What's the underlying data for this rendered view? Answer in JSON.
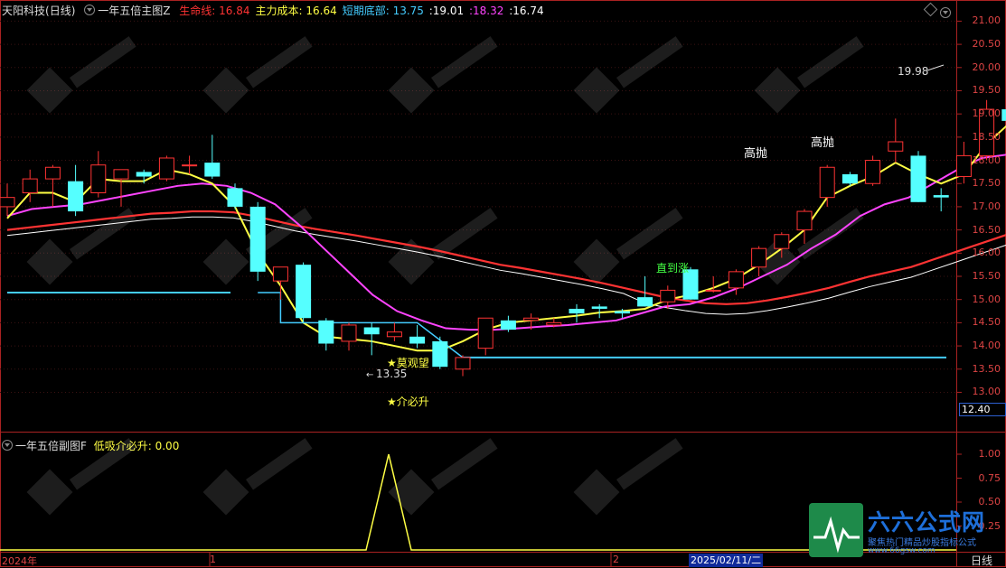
{
  "main_header": {
    "stock": "天阳科技",
    "period": "(日线)",
    "indicator": "一年五倍主图Z",
    "items": [
      {
        "label": "生命线:",
        "value": "16.84",
        "color": "#ff3333"
      },
      {
        "label": "主力成本:",
        "value": "16.64",
        "color": "#ffff44"
      },
      {
        "label": "短期底部:",
        "value": "13.75",
        "color": "#44ccff"
      },
      {
        "label": "",
        "value": ":19.01",
        "color": "#ffffff"
      },
      {
        "label": "",
        "value": ":18.32",
        "color": "#ff44ff"
      },
      {
        "label": "",
        "value": ":16.74",
        "color": "#ffffff"
      }
    ]
  },
  "sub_header": {
    "indicator": "一年五倍副图F",
    "label": "低吸介必升:",
    "value": "0.00"
  },
  "price_axis": {
    "labels": [
      "21.00",
      "20.50",
      "20.00",
      "19.50",
      "19.00",
      "18.50",
      "18.00",
      "17.50",
      "17.00",
      "16.50",
      "16.00",
      "15.50",
      "15.00",
      "14.50",
      "14.00",
      "13.50",
      "13.00"
    ],
    "current_price": "12.40"
  },
  "sub_axis": {
    "labels": [
      "1.00",
      "0.75",
      "0.50",
      "0.25"
    ]
  },
  "date_axis": {
    "start": "2024年",
    "m1": "1",
    "m2": "2",
    "cursor_date": "2025/02/11/二",
    "period": "日线"
  },
  "annotations": {
    "high_price": "19.98",
    "low_price": "13.35",
    "gaopao1": "高抛",
    "gaopao2": "高抛",
    "zhidaozhang": "直到涨",
    "moguanwang": "★莫观望",
    "jiebisheng": "★介必升"
  },
  "watermark": {
    "text": "六六公式网",
    "sub": "聚焦热门精品炒股指标公式",
    "url": "www.66gsw.com"
  },
  "colors": {
    "up": "#ff3333",
    "down": "#55ffff",
    "life": "#ff3333",
    "cost": "#ffff44",
    "bottom": "#44ccff",
    "magenta": "#ff44ff",
    "white": "#ffffff",
    "frame": "#aa2222"
  },
  "chart_data": {
    "type": "candlestick",
    "ylim": [
      12.6,
      21.3
    ],
    "candles": [
      {
        "o": 17.0,
        "h": 17.5,
        "l": 16.8,
        "c": 17.2
      },
      {
        "o": 17.3,
        "h": 17.8,
        "l": 17.1,
        "c": 17.6
      },
      {
        "o": 17.6,
        "h": 17.9,
        "l": 17.0,
        "c": 17.85
      },
      {
        "o": 17.55,
        "h": 17.9,
        "l": 16.8,
        "c": 16.9
      },
      {
        "o": 17.3,
        "h": 18.2,
        "l": 17.2,
        "c": 17.9
      },
      {
        "o": 17.6,
        "h": 17.8,
        "l": 17.0,
        "c": 17.8
      },
      {
        "o": 17.75,
        "h": 17.8,
        "l": 17.5,
        "c": 17.65
      },
      {
        "o": 17.6,
        "h": 18.1,
        "l": 17.55,
        "c": 18.05
      },
      {
        "o": 17.9,
        "h": 18.1,
        "l": 17.7,
        "c": 17.9
      },
      {
        "o": 17.95,
        "h": 18.55,
        "l": 17.6,
        "c": 17.65
      },
      {
        "o": 17.4,
        "h": 17.5,
        "l": 16.95,
        "c": 17.0
      },
      {
        "o": 17.0,
        "h": 17.1,
        "l": 15.4,
        "c": 15.6
      },
      {
        "o": 15.4,
        "h": 15.7,
        "l": 15.0,
        "c": 15.7
      },
      {
        "o": 15.75,
        "h": 15.8,
        "l": 14.5,
        "c": 14.6
      },
      {
        "o": 14.55,
        "h": 14.6,
        "l": 13.9,
        "c": 14.05
      },
      {
        "o": 14.1,
        "h": 14.5,
        "l": 13.9,
        "c": 14.45
      },
      {
        "o": 14.4,
        "h": 14.5,
        "l": 13.8,
        "c": 14.25
      },
      {
        "o": 14.2,
        "h": 14.5,
        "l": 14.1,
        "c": 14.3
      },
      {
        "o": 14.2,
        "h": 14.45,
        "l": 13.95,
        "c": 14.05
      },
      {
        "o": 14.1,
        "h": 14.2,
        "l": 13.5,
        "c": 13.55
      },
      {
        "o": 13.5,
        "h": 13.8,
        "l": 13.35,
        "c": 13.75
      },
      {
        "o": 13.95,
        "h": 14.6,
        "l": 13.8,
        "c": 14.6
      },
      {
        "o": 14.55,
        "h": 14.65,
        "l": 14.3,
        "c": 14.35
      },
      {
        "o": 14.55,
        "h": 14.7,
        "l": 14.35,
        "c": 14.6
      },
      {
        "o": 14.45,
        "h": 14.6,
        "l": 14.4,
        "c": 14.5
      },
      {
        "o": 14.8,
        "h": 14.9,
        "l": 14.5,
        "c": 14.7
      },
      {
        "o": 14.85,
        "h": 14.9,
        "l": 14.6,
        "c": 14.8
      },
      {
        "o": 14.75,
        "h": 14.8,
        "l": 14.6,
        "c": 14.7
      },
      {
        "o": 15.05,
        "h": 15.5,
        "l": 14.85,
        "c": 14.85
      },
      {
        "o": 14.95,
        "h": 15.3,
        "l": 14.8,
        "c": 15.2
      },
      {
        "o": 15.65,
        "h": 15.7,
        "l": 15.0,
        "c": 15.0
      },
      {
        "o": 15.2,
        "h": 15.5,
        "l": 15.15,
        "c": 15.2
      },
      {
        "o": 15.25,
        "h": 15.65,
        "l": 15.1,
        "c": 15.6
      },
      {
        "o": 15.7,
        "h": 16.15,
        "l": 15.5,
        "c": 16.1
      },
      {
        "o": 16.1,
        "h": 16.45,
        "l": 15.9,
        "c": 16.4
      },
      {
        "o": 16.5,
        "h": 16.95,
        "l": 16.2,
        "c": 16.9
      },
      {
        "o": 17.2,
        "h": 17.9,
        "l": 17.0,
        "c": 17.85
      },
      {
        "o": 17.7,
        "h": 17.75,
        "l": 17.45,
        "c": 17.5
      },
      {
        "o": 17.5,
        "h": 18.1,
        "l": 17.45,
        "c": 18.0
      },
      {
        "o": 18.2,
        "h": 18.9,
        "l": 17.95,
        "c": 18.4
      },
      {
        "o": 18.1,
        "h": 18.2,
        "l": 17.1,
        "c": 17.1
      },
      {
        "o": 17.25,
        "h": 17.4,
        "l": 16.9,
        "c": 17.2
      },
      {
        "o": 17.65,
        "h": 18.4,
        "l": 17.5,
        "c": 18.1
      },
      {
        "o": 18.1,
        "h": 19.3,
        "l": 18.0,
        "c": 19.1
      },
      {
        "o": 19.1,
        "h": 19.2,
        "l": 18.9,
        "c": 18.85
      },
      {
        "o": 18.3,
        "h": 18.6,
        "l": 18.25,
        "c": 18.5
      },
      {
        "o": 18.55,
        "h": 19.98,
        "l": 18.1,
        "c": 19.7
      }
    ],
    "life_line": [
      16.5,
      16.55,
      16.6,
      16.65,
      16.7,
      16.75,
      16.8,
      16.85,
      16.87,
      16.9,
      16.9,
      16.88,
      16.8,
      16.7,
      16.6,
      16.52,
      16.45,
      16.38,
      16.3,
      16.22,
      16.14,
      16.05,
      15.95,
      15.85,
      15.75,
      15.68,
      15.6,
      15.52,
      15.44,
      15.35,
      15.25,
      15.15,
      15.05,
      14.98,
      14.92,
      14.9,
      14.92,
      14.98,
      15.06,
      15.15,
      15.25,
      15.38,
      15.5,
      15.6,
      15.7,
      15.85,
      16.0,
      16.15,
      16.3,
      16.45,
      16.6,
      16.84
    ],
    "cost_line": [
      16.75,
      17.3,
      17.3,
      17.1,
      17.6,
      17.55,
      17.55,
      17.8,
      17.7,
      17.5,
      17.0,
      16.0,
      15.3,
      14.5,
      14.2,
      14.15,
      14.1,
      14.0,
      13.9,
      13.9,
      14.1,
      14.35,
      14.5,
      14.55,
      14.6,
      14.65,
      14.72,
      14.75,
      14.8,
      15.0,
      15.1,
      15.25,
      15.45,
      15.75,
      16.1,
      16.5,
      17.2,
      17.45,
      17.65,
      17.95,
      17.7,
      17.5,
      17.7,
      18.35,
      18.8,
      18.85,
      19.01
    ],
    "magenta_line": [
      16.8,
      16.95,
      17.0,
      17.05,
      17.15,
      17.25,
      17.35,
      17.45,
      17.5,
      17.45,
      17.3,
      17.05,
      16.6,
      16.1,
      15.6,
      15.1,
      14.75,
      14.55,
      14.38,
      14.35,
      14.35,
      14.38,
      14.42,
      14.45,
      14.5,
      14.55,
      14.7,
      14.85,
      14.9,
      15.05,
      15.25,
      15.5,
      15.75,
      16.1,
      16.4,
      16.8,
      17.05,
      17.2,
      17.5,
      17.8,
      18.05,
      18.12,
      18.15,
      18.32
    ]
  }
}
